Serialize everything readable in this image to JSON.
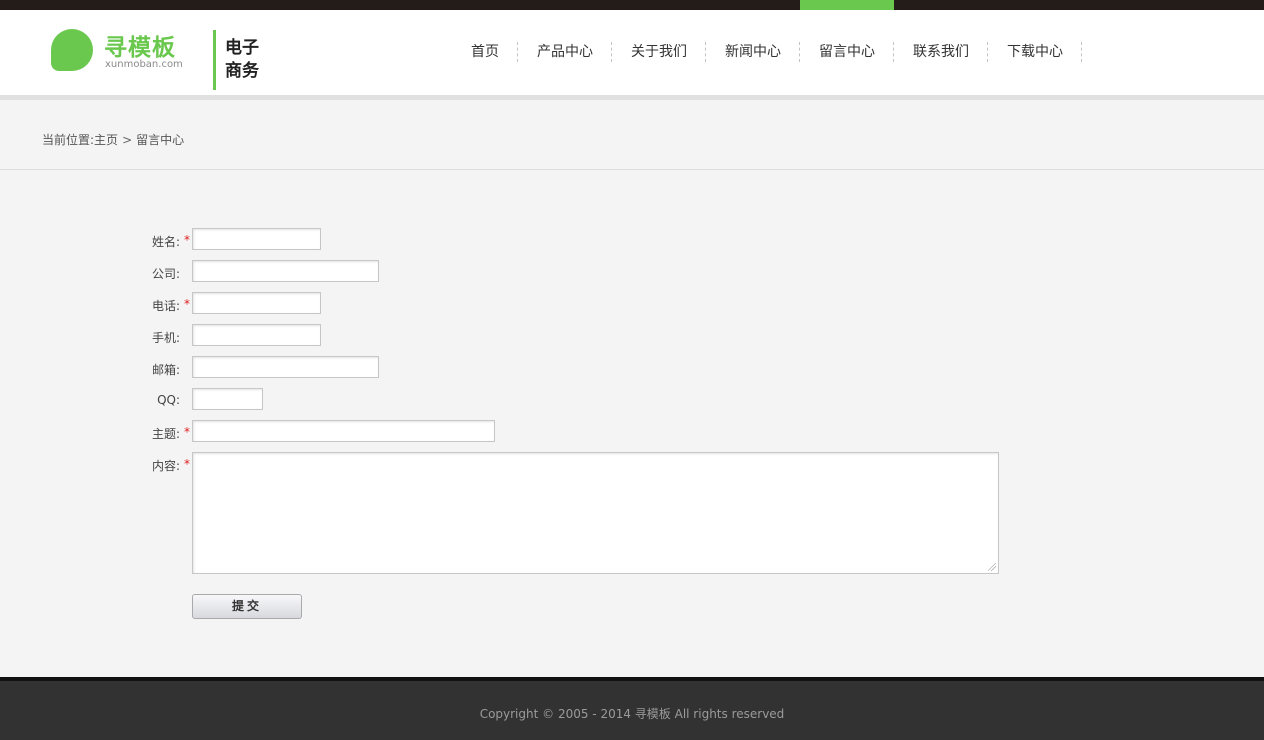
{
  "logo": {
    "cn": "寻模板",
    "en": "xunmoban.com",
    "tag": "电子商务"
  },
  "nav": {
    "items": [
      {
        "label": "首页"
      },
      {
        "label": "产品中心"
      },
      {
        "label": "关于我们"
      },
      {
        "label": "新闻中心"
      },
      {
        "label": "留言中心"
      },
      {
        "label": "联系我们"
      },
      {
        "label": "下载中心"
      }
    ],
    "active_index": 4
  },
  "breadcrumb": {
    "prefix": "当前位置:",
    "home": "主页",
    "sep": ">",
    "current": "留言中心"
  },
  "form": {
    "fields": [
      {
        "label": "姓名:",
        "required": true,
        "value": ""
      },
      {
        "label": "公司:",
        "required": false,
        "value": ""
      },
      {
        "label": "电话:",
        "required": true,
        "value": ""
      },
      {
        "label": "手机:",
        "required": false,
        "value": ""
      },
      {
        "label": "邮箱:",
        "required": false,
        "value": ""
      },
      {
        "label": "QQ:",
        "required": false,
        "value": ""
      },
      {
        "label": "主题:",
        "required": true,
        "value": ""
      },
      {
        "label": "内容:",
        "required": true,
        "value": ""
      }
    ],
    "required_mark": "*",
    "submit_label": "提交"
  },
  "footer": {
    "copyright": "Copyright © 2005 - 2014 寻模板 All rights reserved"
  },
  "colors": {
    "accent": "#6ac84e",
    "topbar": "#231c19",
    "footer": "#323232",
    "required": "#e02020"
  }
}
